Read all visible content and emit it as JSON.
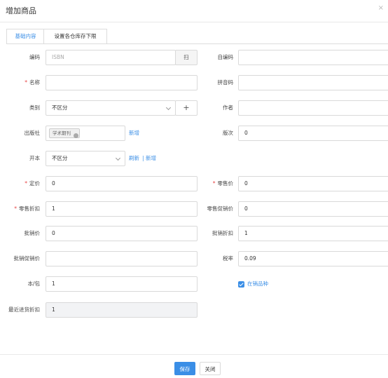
{
  "dialog": {
    "title": "增加商品",
    "close_icon": "×"
  },
  "tabs": [
    {
      "label": "基础内容",
      "active": true
    },
    {
      "label": "设置各仓库存下限",
      "active": false
    }
  ],
  "form": {
    "code": {
      "label": "编码",
      "placeholder": "ISBN",
      "scan_label": "扫"
    },
    "custom_code": {
      "label": "自编码",
      "value": ""
    },
    "name": {
      "label": "名称",
      "required": "*",
      "value": ""
    },
    "pinyin": {
      "label": "拼音码",
      "value": ""
    },
    "category": {
      "label": "类别",
      "value": "不区分",
      "add_icon": "+"
    },
    "author": {
      "label": "作者",
      "value": ""
    },
    "publisher": {
      "label": "出版社",
      "tag": "学术期刊",
      "add_link": "新增"
    },
    "edition": {
      "label": "版次",
      "value": "0"
    },
    "format": {
      "label": "开本",
      "value": "不区分",
      "refresh_link": "刷新",
      "separator": "|",
      "add_link": "新增"
    },
    "list_price": {
      "label": "定价",
      "required": "*",
      "value": "0"
    },
    "retail_price": {
      "label": "零售价",
      "required": "*",
      "value": "0"
    },
    "retail_discount": {
      "label": "零售折扣",
      "required": "*",
      "value": "1"
    },
    "retail_promo_discount": {
      "label": "零售促销价",
      "value": "0"
    },
    "wholesale_price": {
      "label": "批销价",
      "value": "0"
    },
    "wholesale_discount": {
      "label": "批销折扣",
      "value": "1"
    },
    "wholesale_promo_price": {
      "label": "批销促销价",
      "value": ""
    },
    "tax_rate": {
      "label": "税率",
      "value": "0.09"
    },
    "per_pack": {
      "label": "本/包",
      "value": "1"
    },
    "on_sale": {
      "label": "在销品种",
      "checked": true
    },
    "last_purchase_discount": {
      "label": "最近进货折扣",
      "value": "1"
    }
  },
  "footer": {
    "save_label": "保存",
    "close_label": "关闭"
  },
  "colors": {
    "accent": "#3a8ee6",
    "required": "#e64545"
  }
}
